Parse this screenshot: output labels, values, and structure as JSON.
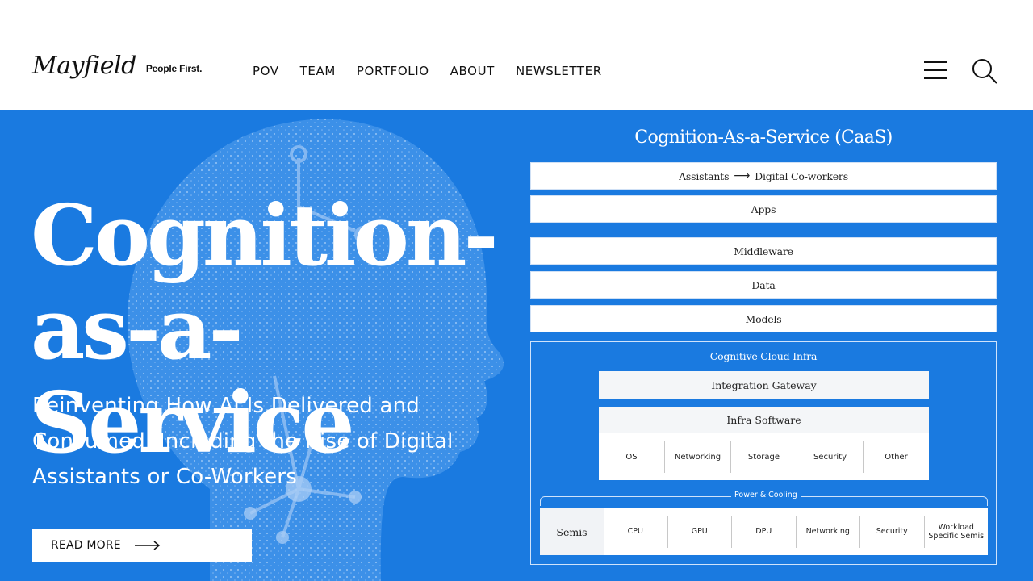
{
  "header": {
    "logo_text": "Mayfield",
    "logo_tagline": "People First.",
    "nav": [
      "POV",
      "TEAM",
      "PORTFOLIO",
      "ABOUT",
      "NEWSLETTER"
    ]
  },
  "hero": {
    "title_line1": "Cognition-",
    "title_line2": "as-a-Service",
    "subtitle": "Reinventing How AI Is Delivered and Consumed, Including the Rise of Digital Assistants or Co-Workers",
    "cta_label": "READ MORE",
    "background_color": "#1a7ae0"
  },
  "diagram": {
    "title": "Cognition-As-a-Service (CaaS)",
    "assistants_from": "Assistants",
    "assistants_to": "Digital Co-workers",
    "layers": [
      "Apps",
      "Middleware",
      "Data",
      "Models"
    ],
    "infra_title": "Cognitive Cloud Infra",
    "integration_gateway": "Integration Gateway",
    "infra_software": {
      "title": "Infra Software",
      "items": [
        "OS",
        "Networking",
        "Storage",
        "Security",
        "Other"
      ]
    },
    "power_cooling": "Power & Cooling",
    "semis": {
      "title": "Semis",
      "items": [
        "CPU",
        "GPU",
        "DPU",
        "Networking",
        "Security",
        "Workload Specific Semis"
      ]
    }
  },
  "icons": {
    "menu": "hamburger-menu-icon",
    "search": "search-icon",
    "cta_arrow": "arrow-right-icon"
  }
}
